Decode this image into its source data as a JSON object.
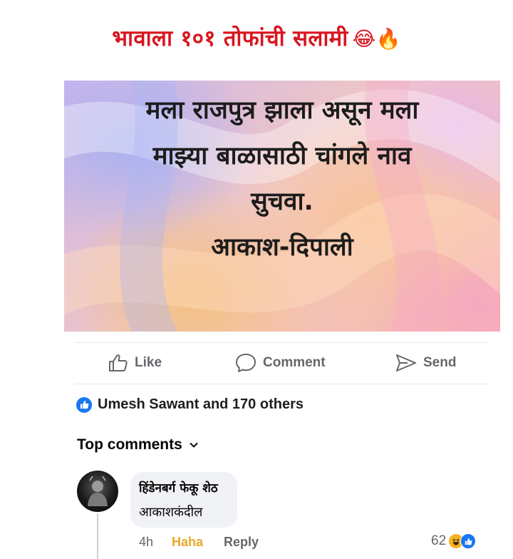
{
  "headline": {
    "text": "भावाला १०१ तोफांची सलामी",
    "emojis": "😂🔥"
  },
  "post": {
    "lines": [
      "मला राजपुत्र झाला असून मला",
      "माझ्या बाळासाठी चांगले नाव",
      "सुचवा.",
      "आकाश-दिपाली"
    ]
  },
  "actions": {
    "like": "Like",
    "comment": "Comment",
    "send": "Send"
  },
  "reactions": {
    "summary": "Umesh Sawant and 170 others",
    "icon": "like-badge-icon"
  },
  "comments": {
    "filter_label": "Top comments",
    "items": [
      {
        "author": "हिंडेनबर्ग फेकू शेठ",
        "text": "आकाशकंदील",
        "time": "4h",
        "reaction_label": "Haha",
        "reply_label": "Reply",
        "reaction_count": "62"
      }
    ]
  },
  "colors": {
    "headline": "#d8151f",
    "facebook_blue": "#1877f2",
    "haha": "#e8a82a",
    "meta_gray": "#65676b"
  }
}
